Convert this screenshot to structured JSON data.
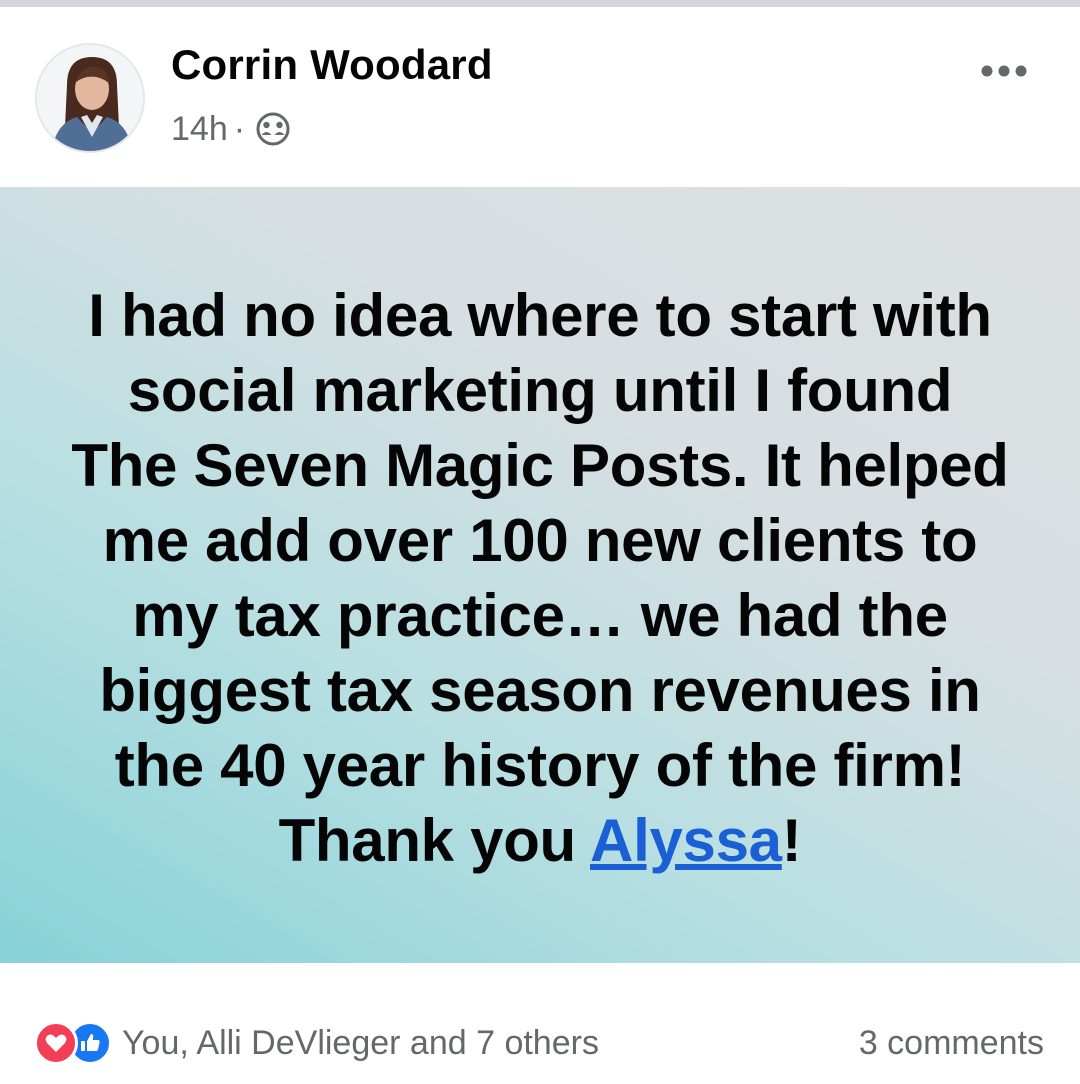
{
  "post": {
    "author": "Corrin Woodard",
    "time": "14h",
    "separator": "·",
    "audience_icon": "friends-icon",
    "text_before_mention": "I had no idea where to start with social marketing until I found The Seven Magic Posts. It helped me add over 100 new clients to my tax practice… we had the biggest tax season revenues in the 40 year history of the firm! Thank you ",
    "mention": "Alyssa",
    "text_after_mention": "!"
  },
  "footer": {
    "reactions_text": "You, Alli DeVlieger and 7 others",
    "comments_text": "3 comments"
  },
  "colors": {
    "mention": "#1a5fd4",
    "love": "#f33e58",
    "like": "#1877f2",
    "meta": "#65676b"
  }
}
